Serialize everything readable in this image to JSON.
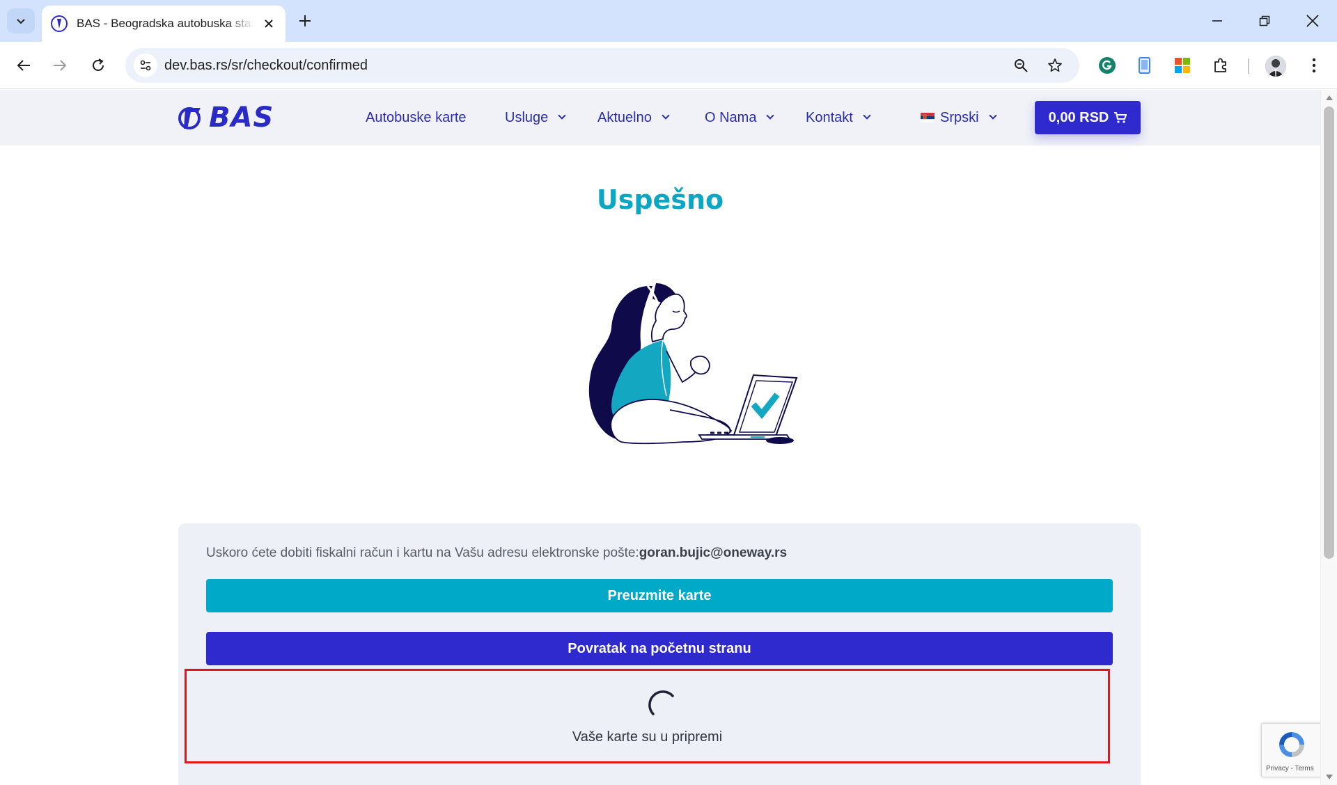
{
  "browser": {
    "tab_title": "BAS - Beogradska autobuska stanica",
    "url": "dev.bas.rs/sr/checkout/confirmed"
  },
  "site": {
    "logo_text": "BAS",
    "nav": [
      {
        "label": "Autobuske karte"
      },
      {
        "label": "Usluge"
      },
      {
        "label": "Aktuelno"
      },
      {
        "label": "O Nama"
      },
      {
        "label": "Kontakt"
      }
    ],
    "language": "Srpski",
    "cart_label": "0,00 RSD"
  },
  "main": {
    "title": "Uspešno",
    "info_text": "Uskoro ćete dobiti fiskalni račun i kartu na Vašu adresu elektronske pošte:",
    "email": "goran.bujic@oneway.rs",
    "download_button": "Preuzmite karte",
    "home_button": "Povratak na početnu stranu",
    "preparing_text": "Vaše karte su u pripremi"
  },
  "recaptcha": {
    "links": "Privacy - Terms"
  },
  "colors": {
    "brand_blue": "#2f2acd",
    "accent_teal": "#00a9c8",
    "highlight_red": "#e0161b"
  }
}
